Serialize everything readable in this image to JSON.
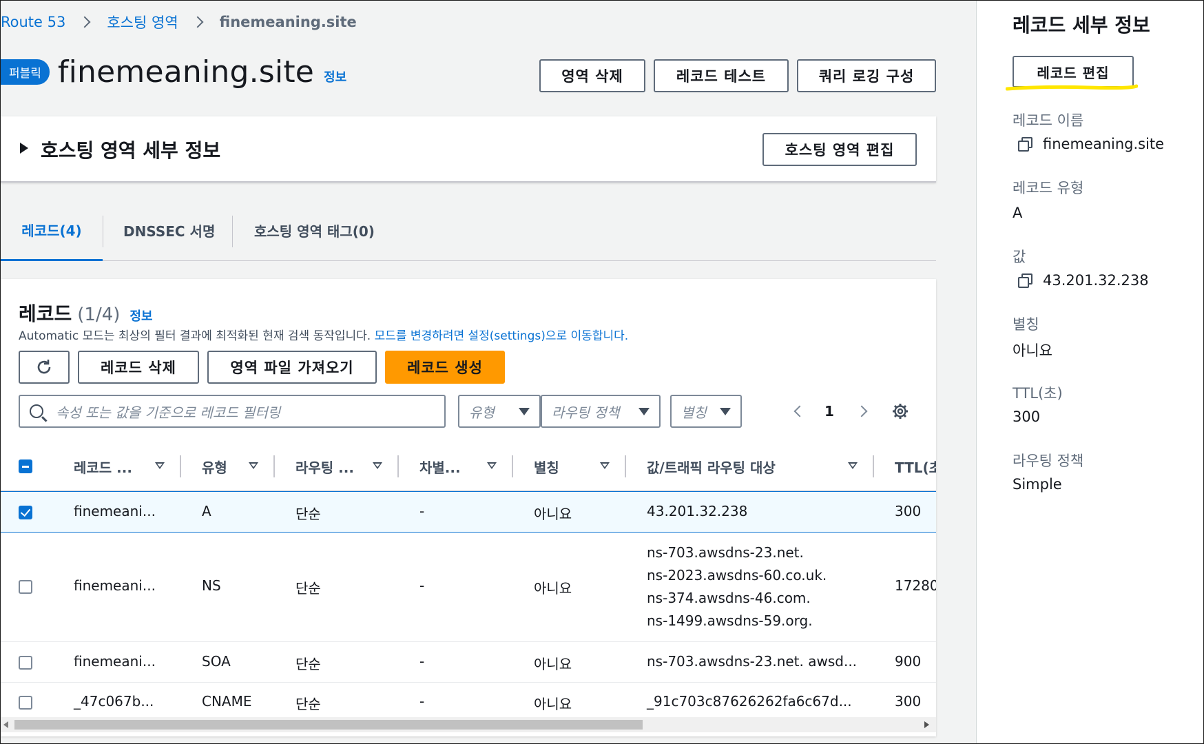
{
  "breadcrumb": {
    "root": "Route 53",
    "zones": "호스팅 영역",
    "current": "finemeaning.site"
  },
  "header": {
    "badge": "퍼블릭",
    "title": "finemeaning.site",
    "info": "정보"
  },
  "actions": {
    "delete_zone": "영역 삭제",
    "test_record": "레코드 테스트",
    "query_logging": "쿼리 로깅 구성"
  },
  "hz_details": {
    "label": "호스팅 영역 세부 정보",
    "edit": "호스팅 영역 편집"
  },
  "tabs": [
    {
      "label": "레코드(4)",
      "active": true
    },
    {
      "label": "DNSSEC 서명",
      "active": false
    },
    {
      "label": "호스팅 영역 태그(0)",
      "active": false
    }
  ],
  "records": {
    "title": "레코드",
    "count": "(1/4)",
    "info": "정보",
    "description": "Automatic 모드는 최상의 필터 결과에 최적화된 현재 검색 동작입니다. ",
    "description_link": "모드를 변경하려면 설정(settings)으로 이동합니다.",
    "buttons": {
      "delete": "레코드 삭제",
      "import": "영역 파일 가져오기",
      "create": "레코드 생성"
    },
    "search_placeholder": "속성 또는 값을 기준으로 레코드 필터링",
    "filters": {
      "type": "유형",
      "routing": "라우팅 정책",
      "alias": "별칭"
    },
    "page": "1",
    "columns": [
      "레코드 ...",
      "유형",
      "라우팅 ...",
      "차별...",
      "별칭",
      "값/트래픽 라우팅 대상",
      "TTL(초"
    ],
    "rows": [
      {
        "name": "finemeani...",
        "type": "A",
        "routing": "단순",
        "diff": "-",
        "alias": "아니요",
        "value": [
          "43.201.32.238"
        ],
        "ttl": "300",
        "selected": true
      },
      {
        "name": "finemeani...",
        "type": "NS",
        "routing": "단순",
        "diff": "-",
        "alias": "아니요",
        "value": [
          "ns-703.awsdns-23.net.",
          "ns-2023.awsdns-60.co.uk.",
          "ns-374.awsdns-46.com.",
          "ns-1499.awsdns-59.org."
        ],
        "ttl": "17280",
        "selected": false
      },
      {
        "name": "finemeani...",
        "type": "SOA",
        "routing": "단순",
        "diff": "-",
        "alias": "아니요",
        "value": [
          "ns-703.awsdns-23.net. awsd..."
        ],
        "ttl": "900",
        "selected": false
      },
      {
        "name": "_47c067b...",
        "type": "CNAME",
        "routing": "단순",
        "diff": "-",
        "alias": "아니요",
        "value": [
          "_91c703c87626262fa6c67d..."
        ],
        "ttl": "300",
        "selected": false
      }
    ]
  },
  "detail_panel": {
    "title": "레코드 세부 정보",
    "edit": "레코드 편집",
    "highlight_color": "#ffe600",
    "fields": {
      "name_label": "레코드 이름",
      "name_value": "finemeaning.site",
      "type_label": "레코드 유형",
      "type_value": "A",
      "value_label": "값",
      "value_value": "43.201.32.238",
      "alias_label": "별칭",
      "alias_value": "아니요",
      "ttl_label": "TTL(초)",
      "ttl_value": "300",
      "routing_label": "라우팅 정책",
      "routing_value": "Simple"
    }
  }
}
